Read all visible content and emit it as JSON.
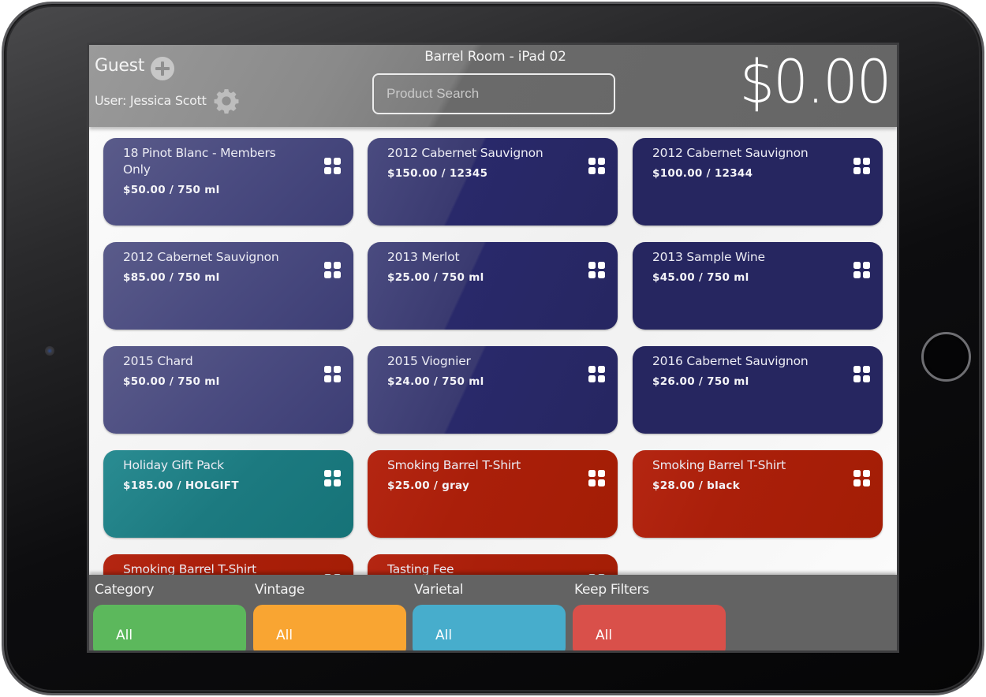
{
  "header": {
    "guest_label": "Guest",
    "user_label": "User: Jessica Scott",
    "location_title": "Barrel Room - iPad 02",
    "search": {
      "placeholder": "Product Search",
      "value": ""
    },
    "total": "$0.00",
    "icons": {
      "add_guest": "plus-circle-icon",
      "settings": "gear-icon"
    }
  },
  "products": [
    {
      "name": "18 Pinot Blanc - Members Only",
      "price": "$50.00 / 750 ml",
      "style": "wine",
      "color": "#4a4b80"
    },
    {
      "name": "2012 Cabernet Sauvignon",
      "price": "$150.00 / 12345",
      "style": "wine",
      "color": "#262661"
    },
    {
      "name": "2012 Cabernet Sauvignon",
      "price": "$100.00 / 12344",
      "style": "wine",
      "color": "#262661"
    },
    {
      "name": "2012 Cabernet Sauvignon",
      "price": "$85.00 / 750 ml",
      "style": "wine",
      "color": "#4a4b80"
    },
    {
      "name": "2013 Merlot",
      "price": "$25.00 / 750 ml",
      "style": "wine",
      "color": "#262661"
    },
    {
      "name": "2013 Sample Wine",
      "price": "$45.00 / 750 ml",
      "style": "wine",
      "color": "#262661"
    },
    {
      "name": "2015 Chard",
      "price": "$50.00 / 750 ml",
      "style": "wine",
      "color": "#4a4b80"
    },
    {
      "name": "2015 Viognier",
      "price": "$24.00 / 750 ml",
      "style": "wine",
      "color": "#262661"
    },
    {
      "name": "2016 Cabernet Sauvignon",
      "price": "$26.00 / 750 ml",
      "style": "wine",
      "color": "#262661"
    },
    {
      "name": "Holiday Gift Pack",
      "price": "$185.00 / HOLGIFT",
      "style": "teal",
      "color": "#1c7a80"
    },
    {
      "name": "Smoking Barrel T-Shirt",
      "price": "$25.00 / gray",
      "style": "red",
      "color": "#a31d05"
    },
    {
      "name": "Smoking Barrel T-Shirt",
      "price": "$28.00 / black",
      "style": "red",
      "color": "#a31d05"
    },
    {
      "name": "Smoking Barrel T-Shirt",
      "price": "",
      "style": "red",
      "color": "#a31d05"
    },
    {
      "name": "Tasting Fee",
      "price": "",
      "style": "red",
      "color": "#a31d05"
    }
  ],
  "filters": [
    {
      "label": "Category",
      "value": "All",
      "color": "#5cb85c"
    },
    {
      "label": "Vintage",
      "value": "All",
      "color": "#f9a532"
    },
    {
      "label": "Varietal",
      "value": "All",
      "color": "#47adcc"
    },
    {
      "label": "Keep Filters",
      "value": "All",
      "color": "#d9504a"
    }
  ],
  "colors": {
    "header_bg": "#7a7a7a",
    "filter_bar_bg": "#636363",
    "wine_card": "#262661",
    "gift_card": "#1c7a80",
    "merch_card": "#a31d05"
  }
}
